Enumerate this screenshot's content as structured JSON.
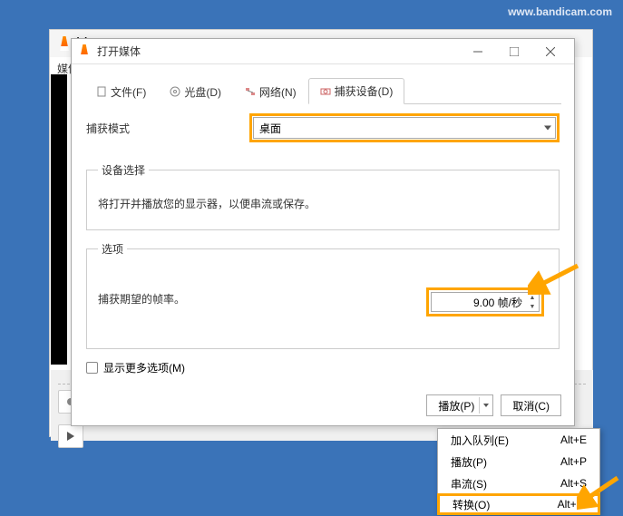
{
  "watermark": "www.bandicam.com",
  "bg_window": {
    "title_prefix": "V",
    "menu_media": "媒体("
  },
  "dialog": {
    "title": "打开媒体",
    "tabs": {
      "file": "文件(F)",
      "disc": "光盘(D)",
      "network": "网络(N)",
      "capture": "捕获设备(D)"
    },
    "capture_mode_label": "捕获模式",
    "capture_mode_value": "桌面",
    "device_section": "设备选择",
    "device_desc": "将打开并播放您的显示器，以便串流或保存。",
    "options_section": "选项",
    "fps_label": "捕获期望的帧率。",
    "fps_value": "9.00 帧/秒",
    "more_options": "显示更多选项(M)",
    "play_btn": "播放(P)",
    "cancel_btn": "取消(C)"
  },
  "menu": {
    "enqueue": {
      "label": "加入队列(E)",
      "shortcut": "Alt+E"
    },
    "play": {
      "label": "播放(P)",
      "shortcut": "Alt+P"
    },
    "stream": {
      "label": "串流(S)",
      "shortcut": "Alt+S"
    },
    "convert": {
      "label": "转换(O)",
      "shortcut": "Alt+O"
    }
  }
}
